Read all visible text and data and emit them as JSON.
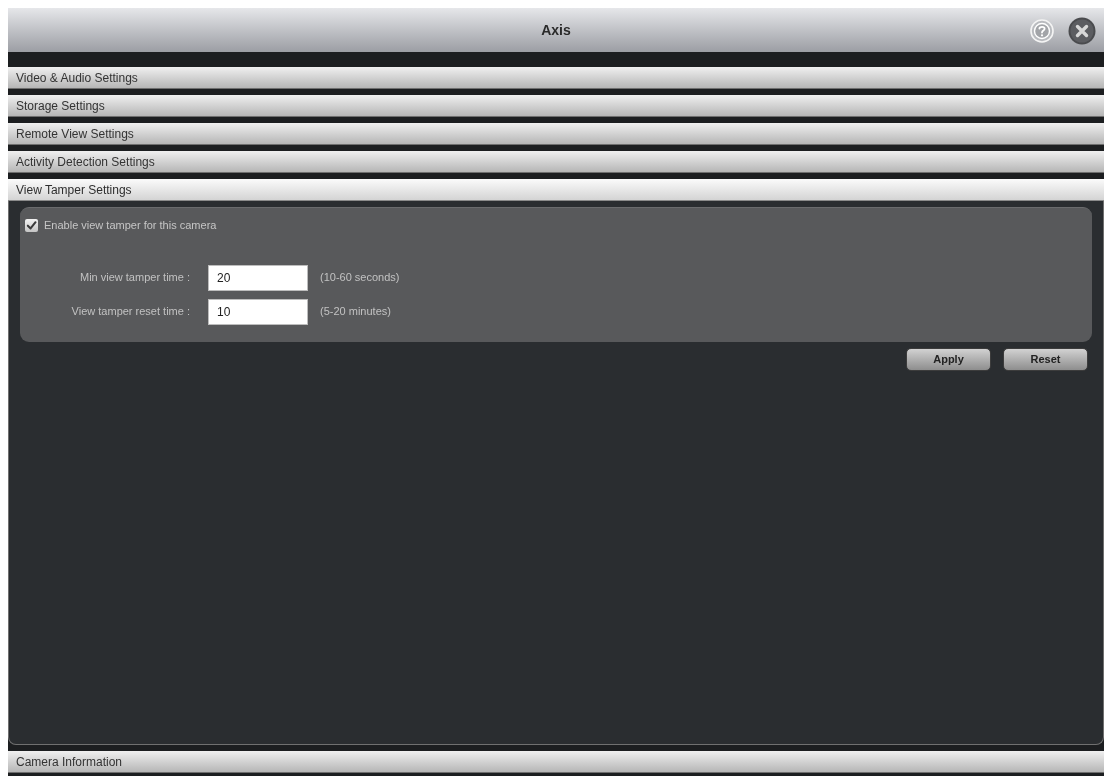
{
  "window": {
    "title": "Axis"
  },
  "sections": [
    {
      "title": "Video & Audio Settings",
      "expanded": false
    },
    {
      "title": "Storage Settings",
      "expanded": false
    },
    {
      "title": "Remote View Settings",
      "expanded": false
    },
    {
      "title": "Activity Detection Settings",
      "expanded": false
    },
    {
      "title": "View Tamper Settings",
      "expanded": true,
      "content": {
        "enable": {
          "label": "Enable view tamper for this camera",
          "checked": true
        },
        "fields": [
          {
            "label": "Min view tamper time :",
            "value": "20",
            "hint": "(10-60 seconds)"
          },
          {
            "label": "View tamper reset time :",
            "value": "10",
            "hint": "(5-20 minutes)"
          }
        ],
        "buttons": [
          "Apply",
          "Reset"
        ]
      }
    },
    {
      "title": "Camera Information",
      "expanded": false
    }
  ]
}
